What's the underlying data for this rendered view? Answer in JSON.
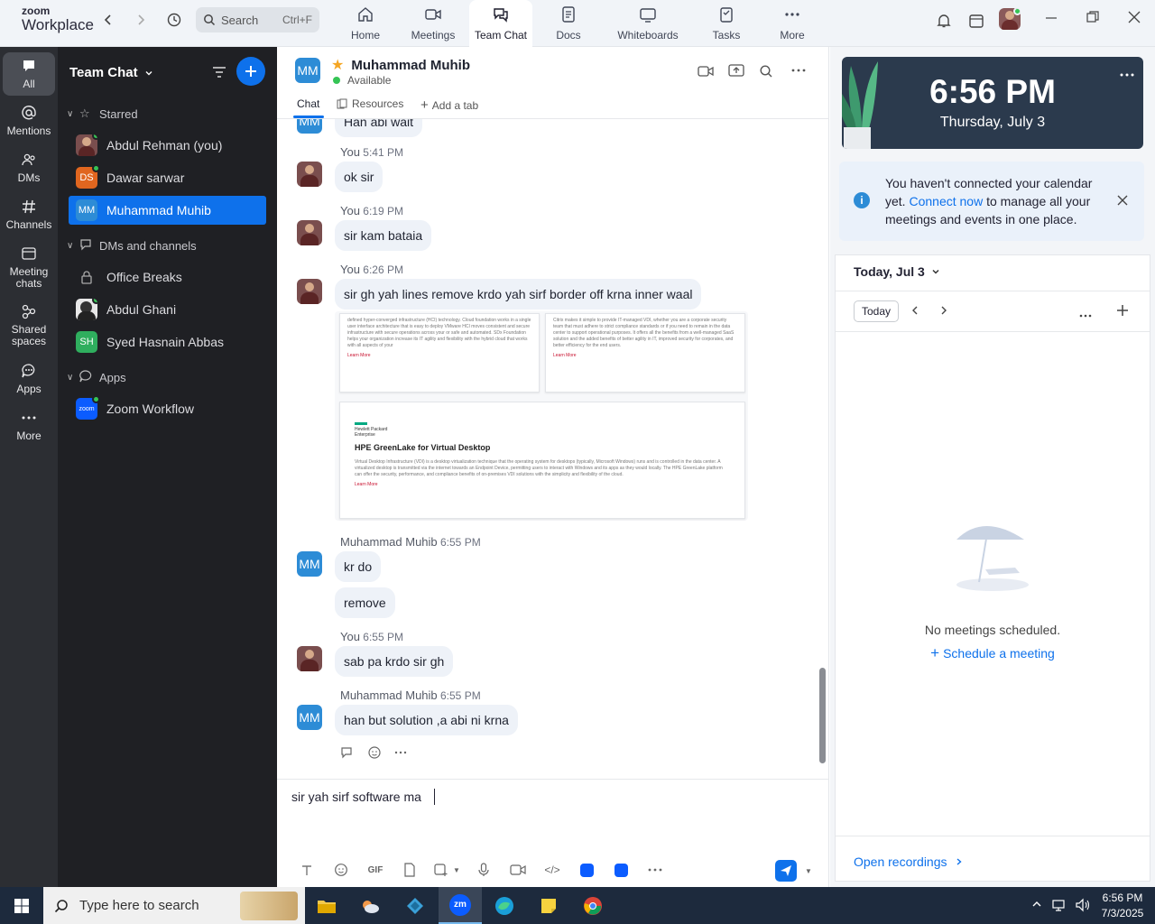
{
  "app": {
    "logo_top": "zoom",
    "logo_bottom": "Workplace"
  },
  "search": {
    "label": "Search",
    "shortcut": "Ctrl+F"
  },
  "nav_tabs": [
    {
      "label": "Home",
      "icon": "home-icon"
    },
    {
      "label": "Meetings",
      "icon": "video-camera-icon"
    },
    {
      "label": "Team Chat",
      "icon": "chat-icon"
    },
    {
      "label": "Docs",
      "icon": "document-icon"
    },
    {
      "label": "Whiteboards",
      "icon": "whiteboard-icon"
    },
    {
      "label": "Tasks",
      "icon": "tasks-icon"
    },
    {
      "label": "More",
      "icon": "more-dots-icon"
    }
  ],
  "rail": [
    {
      "label": "All"
    },
    {
      "label": "Mentions"
    },
    {
      "label": "DMs"
    },
    {
      "label": "Channels"
    },
    {
      "label": "Meeting chats"
    },
    {
      "label": "Shared spaces"
    },
    {
      "label": "Apps"
    },
    {
      "label": "More"
    }
  ],
  "sidebar": {
    "title": "Team Chat",
    "sections": {
      "starred": "Starred",
      "dms": "DMs and channels",
      "apps": "Apps"
    },
    "starred_items": [
      {
        "name": "Abdul Rehman (you)",
        "avatar": "photo"
      },
      {
        "name": "Dawar sarwar",
        "initials": "DS",
        "color": "#e0661f"
      },
      {
        "name": "Muhammad Muhib",
        "initials": "MM",
        "color": "#2d8cd6"
      }
    ],
    "dm_items": [
      {
        "name": "Office Breaks",
        "avatar": "lock"
      },
      {
        "name": "Abdul Ghani",
        "avatar": "photo"
      },
      {
        "name": "Syed Hasnain Abbas",
        "initials": "SH",
        "color": "#2fae5e"
      }
    ],
    "app_items": [
      {
        "name": "Zoom Workflow",
        "badge": "zoom"
      }
    ]
  },
  "chat": {
    "header": {
      "initials": "MM",
      "name": "Muhammad Muhib",
      "status": "Available"
    },
    "tabs": {
      "chat": "Chat",
      "resources": "Resources",
      "add_tab": "Add a tab"
    },
    "partial_top": "Han abi wait",
    "messages": [
      {
        "meta_name": "You",
        "time": "5:41 PM",
        "texts": [
          "ok sir"
        ]
      },
      {
        "meta_name": "You",
        "time": "6:19 PM",
        "texts": [
          "sir kam bataia"
        ]
      },
      {
        "meta_name": "You",
        "time": "6:26 PM",
        "texts": [
          "sir gh yah lines remove krdo yah sirf border off krna inner waal"
        ]
      },
      {
        "meta_name": "Muhammad Muhib",
        "time": "6:55 PM",
        "texts": [
          "kr do",
          "remove"
        ]
      },
      {
        "meta_name": "You",
        "time": "6:55 PM",
        "texts": [
          "sab pa krdo sir gh"
        ]
      },
      {
        "meta_name": "Muhammad Muhib",
        "time": "6:55 PM",
        "texts": [
          "han but solution ,a abi ni krna"
        ]
      }
    ],
    "attachment": {
      "card1_text": "defined hyper-converged infrastructure (HCI) technology. Cloud foundation works in a single user interface architecture that is easy to deploy VMware HCI moves consistent and secure infrastructure with secure operations across your or safe and automated. SDx Foundation helps your organization increase its IT agility and flexibility with the hybrid cloud that works with all aspects of your",
      "card2_text": "Citrix makes it simple to provide IT-managed VDI, whether you are a corporate security team that must adhere to strict compliance standards or if you need to remain in the data center to support operational purposes. It offers all the benefits from a well-managed SaaS solution and the added benefits of better agility in IT, improved security for corporates, and better efficiency for the end users.",
      "learn_more": "Learn More",
      "card3_brand": "Hewlett Packard Enterprise",
      "card3_title": "HPE GreenLake for Virtual Desktop",
      "card3_text": "Virtual Desktop Infrastructure (VDI) is a desktop virtualization technique that the operating system for desktops (typically, Microsoft Windows) runs and is controlled in the data center. A virtualized desktop is transmitted via the internet towards an Endpoint Device, permitting users to interact with Windows and its apps as they would locally. The HPE GreenLake platform can offer the security, performance, and compliance benefits of on-premises VDI solutions with the simplicity and flexibility of the cloud."
    },
    "composer_text": "sir yah sirf software ma"
  },
  "right_panel": {
    "clock_time": "6:56 PM",
    "clock_date": "Thursday, July 3",
    "notice_prefix": "You haven't connected your calendar yet. ",
    "notice_link": "Connect now",
    "notice_suffix": " to manage all your meetings and events in one place.",
    "date_label": "Today, Jul 3",
    "today_button": "Today",
    "empty_text": "No meetings scheduled.",
    "schedule_link": "Schedule a meeting",
    "open_recordings": "Open recordings"
  },
  "taskbar": {
    "search_placeholder": "Type here to search",
    "time": "6:56 PM",
    "date": "7/3/2025"
  },
  "colors": {
    "accent": "#0e71eb",
    "rail_bg": "#2c2e33",
    "sidebar_bg": "#1f2024",
    "bubble_bg": "#eef2f8",
    "clock_bg": "#2b3a4d",
    "presence": "#35c455"
  }
}
